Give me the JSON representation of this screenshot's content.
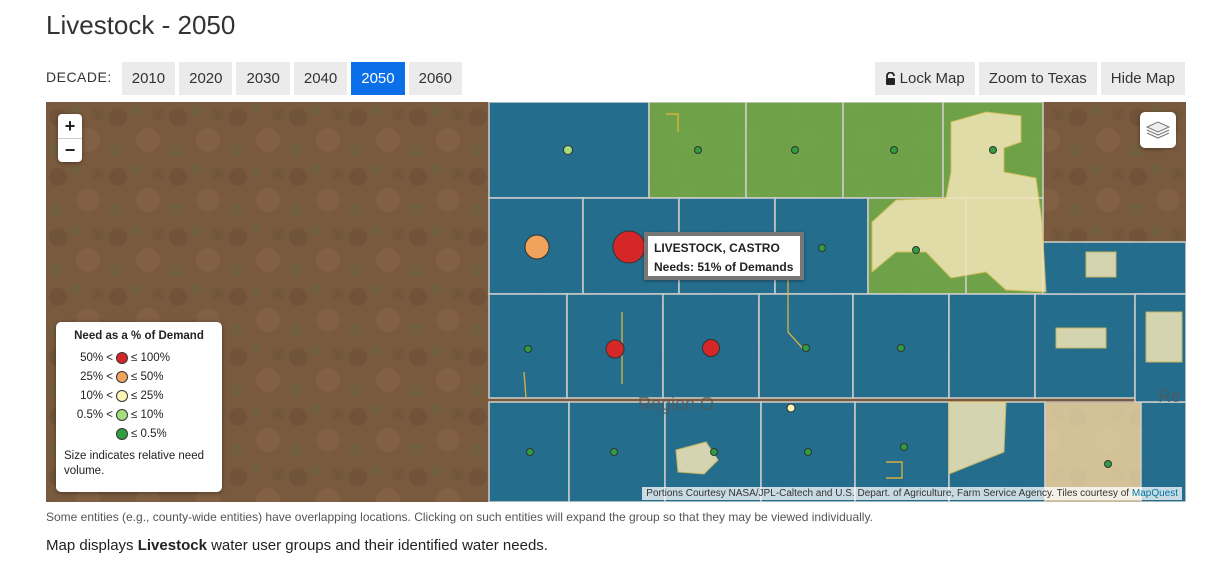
{
  "page": {
    "title": "Livestock - 2050"
  },
  "decades": {
    "label": "DECADE:",
    "items": [
      "2010",
      "2020",
      "2030",
      "2040",
      "2050",
      "2060"
    ],
    "selected": "2050"
  },
  "map_controls": {
    "lock": "Lock Map",
    "zoom_texas": "Zoom to Texas",
    "hide": "Hide Map"
  },
  "map": {
    "zoom_in": "+",
    "zoom_out": "−",
    "popup": {
      "title": "LIVESTOCK, CASTRO",
      "needs": "Needs: 51% of Demands"
    },
    "region_label": "Region O",
    "region_label_right": "Re",
    "attribution": "Portions Courtesy NASA/JPL-Caltech and U.S. Depart. of Agriculture, Farm Service Agency. Tiles courtesy of",
    "attribution_link": "MapQuest",
    "colors": {
      "region_blue": "#1e6f94",
      "region_green": "#6fa84a",
      "region_cream": "#f3e7b8"
    }
  },
  "legend": {
    "title": "Need as a % of Demand",
    "rows": [
      {
        "range": "50% <",
        "color": "#d62728",
        "max": "≤ 100%"
      },
      {
        "range": "25% <",
        "color": "#f0a35c",
        "max": "≤ 50%"
      },
      {
        "range": "10% <",
        "color": "#fbf6b7",
        "max": "≤ 25%"
      },
      {
        "range": "0.5% <",
        "color": "#a5dd7a",
        "max": "≤ 10%"
      },
      {
        "range": "",
        "color": "#2e9e3f",
        "max": "≤ 0.5%"
      }
    ],
    "note": "Size indicates relative need volume."
  },
  "caption": "Some entities (e.g., county-wide entities) have overlapping locations. Clicking on such entities will expand the group so that they may be viewed individually.",
  "description": {
    "before": "Map displays ",
    "bold": "Livestock",
    "after": " water user groups and their identified water needs."
  }
}
